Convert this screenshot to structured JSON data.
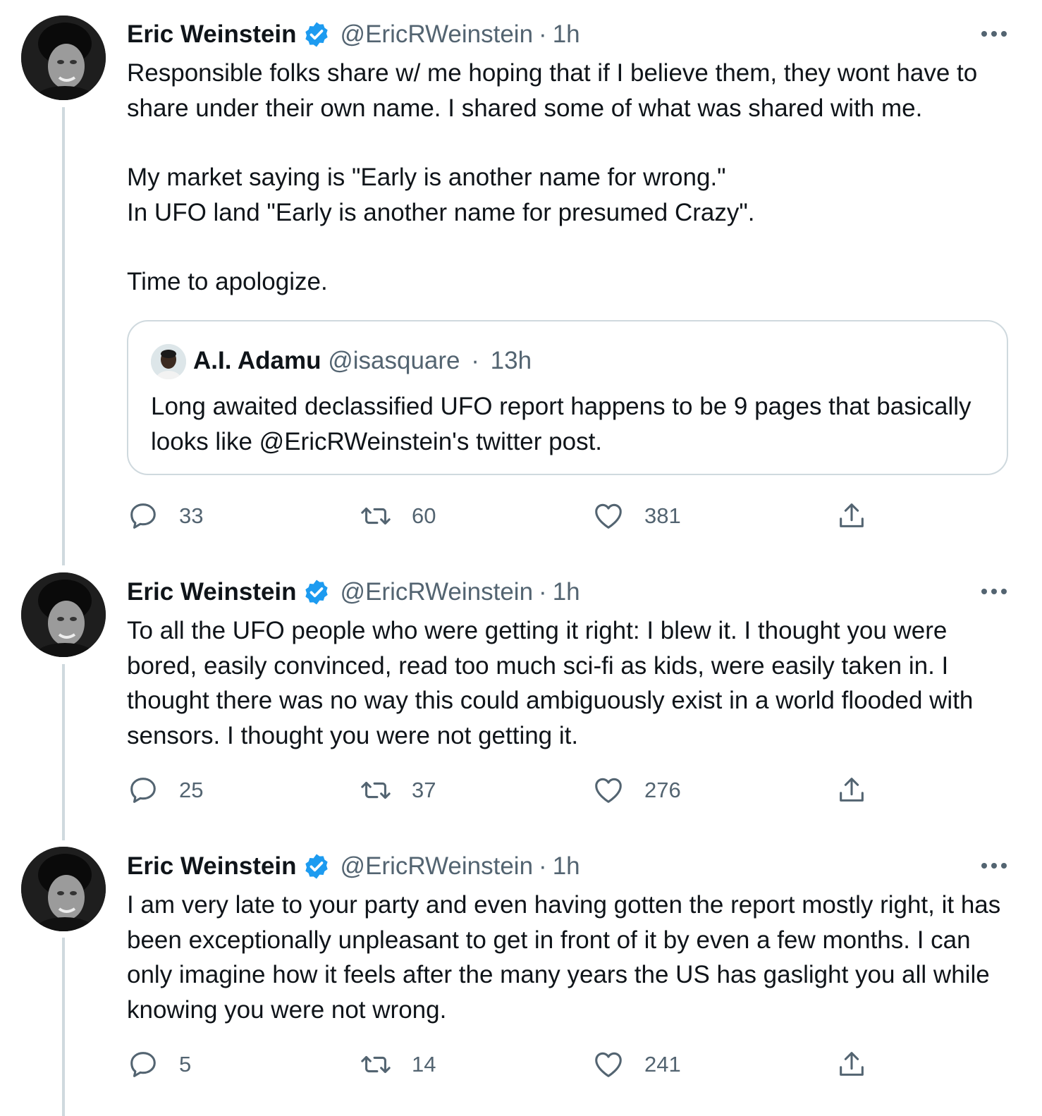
{
  "tweets": [
    {
      "author": "Eric Weinstein",
      "handle": "@EricRWeinstein",
      "sep": "·",
      "time": "1h",
      "paragraphs": [
        "Responsible folks share w/ me hoping that if I believe them, they wont have to share under their own name. I shared some of what was shared with me.",
        "My market saying is \"Early is another name for wrong.\"\nIn UFO land \"Early is another name for presumed Crazy\".",
        "Time to apologize."
      ],
      "quote": {
        "author": "A.I. Adamu",
        "handle": "@isasquare",
        "sep": "·",
        "time": "13h",
        "text": "Long awaited declassified UFO report happens to be 9 pages that basically looks like @EricRWeinstein's twitter post."
      },
      "replies": "33",
      "retweets": "60",
      "likes": "381"
    },
    {
      "author": "Eric Weinstein",
      "handle": "@EricRWeinstein",
      "sep": "·",
      "time": "1h",
      "paragraphs": [
        "To all the UFO people who were getting it right: I blew it. I thought you were bored, easily convinced, read too much sci-fi as kids, were easily taken in. I thought there was no way this could ambiguously exist in a world flooded with sensors. I thought you were not getting it."
      ],
      "replies": "25",
      "retweets": "37",
      "likes": "276"
    },
    {
      "author": "Eric Weinstein",
      "handle": "@EricRWeinstein",
      "sep": "·",
      "time": "1h",
      "paragraphs": [
        "I am very late to your party and even having gotten the report mostly right, it has been exceptionally unpleasant to get in front of it by even a few months. I can only imagine how it feels after the many years the US has gaslight you all while knowing you were not wrong."
      ],
      "replies": "5",
      "retweets": "14",
      "likes": "241"
    }
  ],
  "icons": {
    "verified": "verified-badge-icon",
    "more": "more-horizontal-icon",
    "reply": "reply-icon",
    "retweet": "retweet-icon",
    "like": "heart-icon",
    "share": "share-icon"
  },
  "colors": {
    "text": "#0f1419",
    "secondary": "#536471",
    "verified": "#1d9bf0",
    "thread_line": "#cfd9de",
    "border": "#cfd9de"
  }
}
